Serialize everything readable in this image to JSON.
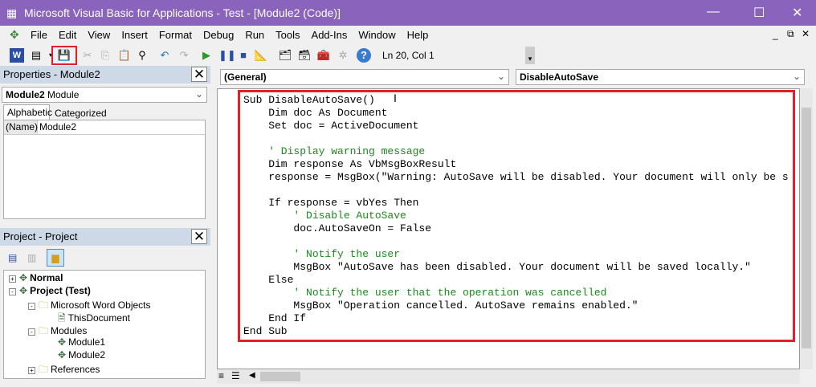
{
  "title": "Microsoft Visual Basic for Applications - Test - [Module2 (Code)]",
  "menu": [
    "File",
    "Edit",
    "View",
    "Insert",
    "Format",
    "Debug",
    "Run",
    "Tools",
    "Add-Ins",
    "Window",
    "Help"
  ],
  "toolbar": {
    "position": "Ln 20, Col 1"
  },
  "properties": {
    "title": "Properties - Module2",
    "object": "Module2",
    "object_type": "Module",
    "tabs": [
      "Alphabetic",
      "Categorized"
    ],
    "rows": [
      {
        "name": "(Name)",
        "value": "Module2"
      }
    ]
  },
  "project": {
    "title": "Project - Project",
    "tree": [
      {
        "label": "Normal",
        "bold": true,
        "level": 0,
        "exp": "+"
      },
      {
        "label": "Project (Test)",
        "bold": true,
        "level": 0,
        "exp": "-"
      },
      {
        "label": "Microsoft Word Objects",
        "level": 1,
        "exp": "-"
      },
      {
        "label": "ThisDocument",
        "level": 2
      },
      {
        "label": "Modules",
        "level": 1,
        "exp": "-"
      },
      {
        "label": "Module1",
        "level": 2
      },
      {
        "label": "Module2",
        "level": 2
      },
      {
        "label": "References",
        "level": 1,
        "exp": "+"
      }
    ]
  },
  "code": {
    "object": "(General)",
    "procedure": "DisableAutoSave",
    "lines": [
      "Sub DisableAutoSave()",
      "    Dim doc As Document",
      "    Set doc = ActiveDocument",
      "",
      "    ' Display warning message",
      "    Dim response As VbMsgBoxResult",
      "    response = MsgBox(\"Warning: AutoSave will be disabled. Your document will only be s",
      "",
      "    If response = vbYes Then",
      "        ' Disable AutoSave",
      "        doc.AutoSaveOn = False",
      "",
      "        ' Notify the user",
      "        MsgBox \"AutoSave has been disabled. Your document will be saved locally.\"",
      "    Else",
      "        ' Notify the user that the operation was cancelled",
      "        MsgBox \"Operation cancelled. AutoSave remains enabled.\"",
      "    End If",
      "End Sub"
    ]
  },
  "colors": {
    "title": "#8a63bd",
    "highlight": "#e0202a",
    "comment": "#1a8a1a"
  }
}
